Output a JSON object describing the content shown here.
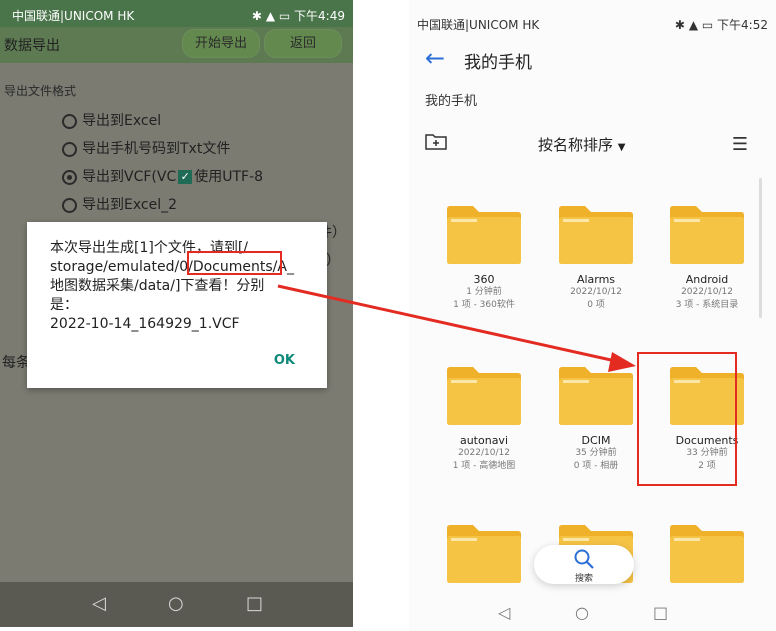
{
  "left": {
    "status": {
      "carrier": "中国联通|UNICOM HK",
      "time": "下午4:49"
    },
    "toolbar": {
      "title": "数据导出",
      "start_label": "开始导出",
      "back_label": "返回"
    },
    "section_label": "导出文件格式",
    "options": [
      {
        "label": "导出到Excel"
      },
      {
        "label": "导出手机号码到Txt文件"
      },
      {
        "label": "导出到VCF(VC",
        "suffix": "使用UTF-8"
      },
      {
        "label": "导出到Excel_2"
      }
    ],
    "bg_partial": {
      "right1": "件）",
      "right2": "）",
      "left": "每条"
    },
    "dialog": {
      "message_line1": "本次导出生成[1]个文件，请到[/",
      "message_line2": "storage/emulated/0/Documents/A_",
      "message_line3": "地图数据采集/data/]下查看！分别",
      "message_line4": "是：",
      "message_line5": "2022-10-14_164929_1.VCF",
      "ok_label": "OK"
    }
  },
  "right": {
    "status": {
      "carrier": "中国联通|UNICOM HK",
      "time": "下午4:52"
    },
    "title": "我的手机",
    "breadcrumb": "我的手机",
    "sort_label": "按名称排序",
    "folders": [
      {
        "name": "360",
        "time": "1 分钟前",
        "info": "1 项 - 360软件"
      },
      {
        "name": "Alarms",
        "time": "2022/10/12",
        "info": "0 项"
      },
      {
        "name": "Android",
        "time": "2022/10/12",
        "info": "3 项 - 系统目录"
      },
      {
        "name": "autonavi",
        "time": "2022/10/12",
        "info": "1 项 - 高德地图"
      },
      {
        "name": "DCIM",
        "time": "35 分钟前",
        "info": "0 项 - 相册"
      },
      {
        "name": "Documents",
        "time": "33 分钟前",
        "info": "2 项"
      }
    ],
    "search_label": "搜索"
  },
  "colors": {
    "folder": "#f6c445",
    "folder_dark": "#efb02a",
    "highlight": "#e32b22",
    "accent": "#2b6fd6"
  }
}
